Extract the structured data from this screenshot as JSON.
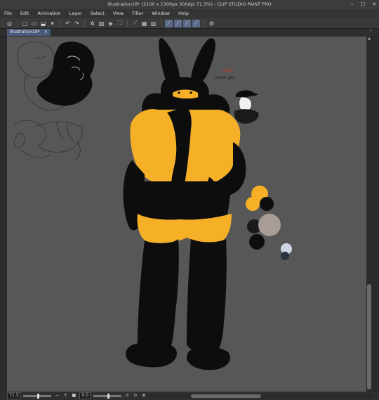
{
  "window": {
    "title": "Illustration18* (2100 x 1300px 300dpi 71.3%)  - CLIP STUDIO PAINT PRO",
    "minimize": "–",
    "maximize": "□",
    "close": "✕"
  },
  "menu": [
    "File",
    "Edit",
    "Animation",
    "Layer",
    "Select",
    "View",
    "Filter",
    "Window",
    "Help"
  ],
  "tab": {
    "label": "Illustration18*",
    "close": "×",
    "dropdown": "˅"
  },
  "canvas_note": "ewe",
  "canvas_note2": "some guy",
  "statusbar": {
    "zoom": "71.3",
    "rotation": "0.0",
    "icons": [
      "minus-icon",
      "plus-icon",
      "stop-icon",
      "rotate-left-icon",
      "rotate-right-icon",
      "reset-icon",
      "flip-icon"
    ]
  },
  "colors": {
    "fur_yellow": "#F6B027",
    "fur_black": "#0D0D0D",
    "canvas_bg": "#575757",
    "accent": "#4A5A7A",
    "swatch_tan": "#A89D96",
    "swatch_blue_white": "#CDD5E2",
    "swatch_dark_blue": "#2E3340"
  }
}
